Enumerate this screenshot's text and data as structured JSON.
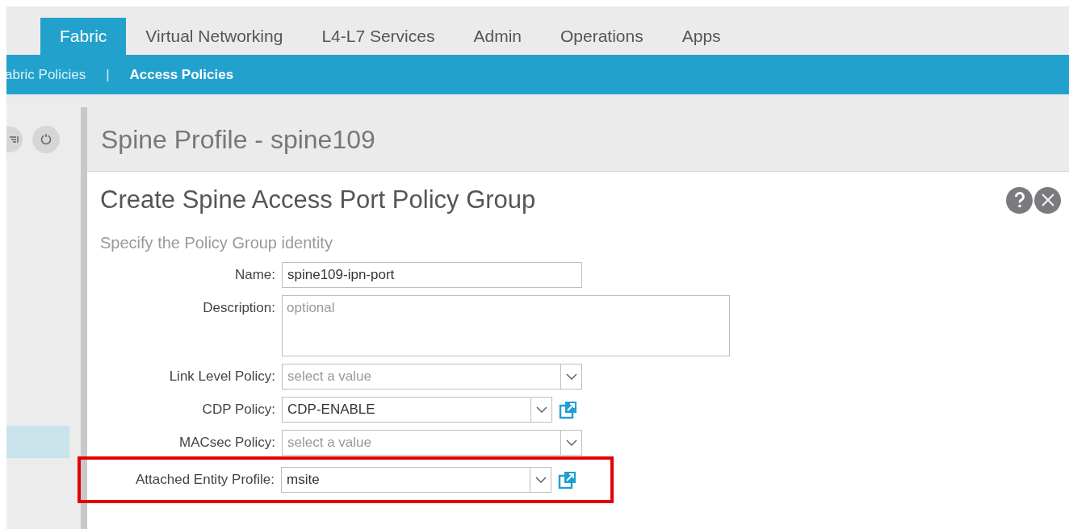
{
  "tabs": [
    {
      "label": "Fabric",
      "selected": true
    },
    {
      "label": "Virtual Networking",
      "selected": false
    },
    {
      "label": "L4-L7 Services",
      "selected": false
    },
    {
      "label": "Admin",
      "selected": false
    },
    {
      "label": "Operations",
      "selected": false
    },
    {
      "label": "Apps",
      "selected": false
    }
  ],
  "subnav": [
    {
      "label": "abric Policies",
      "selected": false
    },
    {
      "label": "Access Policies",
      "selected": true
    }
  ],
  "subnav_separator": "|",
  "sidebar": {
    "items": [
      {
        "selected": true
      }
    ]
  },
  "page_title": "Spine Profile - spine109",
  "dialog": {
    "title": "Create Spine Access Port Policy Group",
    "subtitle": "Specify the Policy Group identity",
    "fields": [
      {
        "kind": "text",
        "label": "Name:",
        "value": "spine109-ipn-port",
        "link": false,
        "highlighted": false
      },
      {
        "kind": "textarea",
        "label": "Description:",
        "placeholder": "optional",
        "link": false,
        "highlighted": false
      },
      {
        "kind": "select",
        "label": "Link Level Policy:",
        "placeholder": "select a value",
        "link": false,
        "highlighted": false
      },
      {
        "kind": "select",
        "label": "CDP Policy:",
        "value": "CDP-ENABLE",
        "link": true,
        "highlighted": false
      },
      {
        "kind": "select",
        "label": "MACsec Policy:",
        "placeholder": "select a value",
        "link": false,
        "highlighted": false
      },
      {
        "kind": "select",
        "label": "Attached Entity Profile:",
        "value": "msite",
        "link": true,
        "highlighted": true
      }
    ]
  }
}
